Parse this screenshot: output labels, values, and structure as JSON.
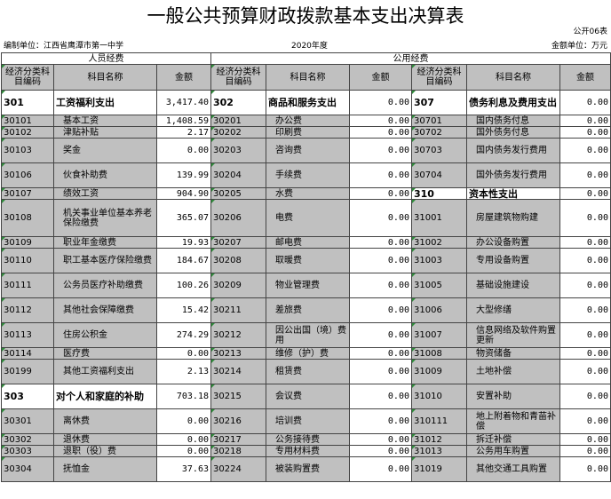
{
  "title": "一般公共预算财政拨款基本支出决算表",
  "table_code": "公开06表",
  "meta": {
    "unit": "编制单位：江西省鹰潭市第一中学",
    "year": "2020年度",
    "money_unit": "金额单位：万元"
  },
  "headers": {
    "personnel": "人员经费",
    "public": "公用经费",
    "code": "经济分类科目编码",
    "name": "科目名称",
    "amount": "金额"
  },
  "rows": [
    {
      "h": 28,
      "c1": "301",
      "n1": "工资福利支出",
      "a1": "3,417.40",
      "c2": "302",
      "n2": "商品和服务支出",
      "a2": "0.00",
      "c3": "307",
      "n3": "债务利息及费用支出",
      "a3": "0.00",
      "b1": true,
      "b2": true,
      "b3": true
    },
    {
      "h": 13,
      "c1": "30101",
      "n1": "基本工资",
      "a1": "1,408.59",
      "c2": "30201",
      "n2": "办公费",
      "a2": "0.00",
      "c3": "30701",
      "n3": "国内债务付息",
      "a3": "0.00"
    },
    {
      "h": 13,
      "c1": "30102",
      "n1": "津贴补贴",
      "a1": "2.17",
      "c2": "30202",
      "n2": "印刷费",
      "a2": "0.00",
      "c3": "30702",
      "n3": "国外债务付息",
      "a3": "0.00"
    },
    {
      "h": 28,
      "c1": "30103",
      "n1": "奖金",
      "a1": "0.00",
      "c2": "30203",
      "n2": "咨询费",
      "a2": "0.00",
      "c3": "30703",
      "n3": "国内债务发行费用",
      "a3": "0.00"
    },
    {
      "h": 28,
      "c1": "30106",
      "n1": "伙食补助费",
      "a1": "139.99",
      "c2": "30204",
      "n2": "手续费",
      "a2": "0.00",
      "c3": "30704",
      "n3": "国外债务发行费用",
      "a3": "0.00"
    },
    {
      "h": 13,
      "c1": "30107",
      "n1": "绩效工资",
      "a1": "904.90",
      "c2": "30205",
      "n2": "水费",
      "a2": "0.00",
      "c3": "310",
      "n3": "资本性支出",
      "a3": "0.00",
      "b3": true
    },
    {
      "h": 42,
      "c1": "30108",
      "n1": "机关事业单位基本养老保险缴费",
      "a1": "365.07",
      "c2": "30206",
      "n2": "电费",
      "a2": "0.00",
      "c3": "31001",
      "n3": "房屋建筑物购建",
      "a3": "0.00"
    },
    {
      "h": 13,
      "c1": "30109",
      "n1": "职业年金缴费",
      "a1": "19.93",
      "c2": "30207",
      "n2": "邮电费",
      "a2": "0.00",
      "c3": "31002",
      "n3": "办公设备购置",
      "a3": "0.00"
    },
    {
      "h": 28,
      "c1": "30110",
      "n1": "职工基本医疗保险缴费",
      "a1": "184.67",
      "c2": "30208",
      "n2": "取暖费",
      "a2": "0.00",
      "c3": "31003",
      "n3": "专用设备购置",
      "a3": "0.00"
    },
    {
      "h": 28,
      "c1": "30111",
      "n1": "公务员医疗补助缴费",
      "a1": "100.26",
      "c2": "30209",
      "n2": "物业管理费",
      "a2": "0.00",
      "c3": "31005",
      "n3": "基础设施建设",
      "a3": "0.00"
    },
    {
      "h": 28,
      "c1": "30112",
      "n1": "其他社会保障缴费",
      "a1": "15.42",
      "c2": "30211",
      "n2": "差旅费",
      "a2": "0.00",
      "c3": "31006",
      "n3": "大型修缮",
      "a3": "0.00"
    },
    {
      "h": 28,
      "c1": "30113",
      "n1": "住房公积金",
      "a1": "274.29",
      "c2": "30212",
      "n2": "因公出国（境）费用",
      "a2": "0.00",
      "c3": "31007",
      "n3": "信息网络及软件购置更新",
      "a3": "0.00"
    },
    {
      "h": 13,
      "c1": "30114",
      "n1": "医疗费",
      "a1": "0.00",
      "c2": "30213",
      "n2": "维修（护）费",
      "a2": "0.00",
      "c3": "31008",
      "n3": "物资储备",
      "a3": "0.00"
    },
    {
      "h": 28,
      "c1": "30199",
      "n1": "其他工资福利支出",
      "a1": "2.13",
      "c2": "30214",
      "n2": "租赁费",
      "a2": "0.00",
      "c3": "31009",
      "n3": "土地补偿",
      "a3": "0.00"
    },
    {
      "h": 28,
      "c1": "303",
      "n1": "对个人和家庭的补助",
      "a1": "703.18",
      "c2": "30215",
      "n2": "会议费",
      "a2": "0.00",
      "c3": "31010",
      "n3": "安置补助",
      "a3": "0.00",
      "b1": true
    },
    {
      "h": 28,
      "c1": "30301",
      "n1": "离休费",
      "a1": "0.00",
      "c2": "30216",
      "n2": "培训费",
      "a2": "0.00",
      "c3": "310111",
      "n3": "地上附着物和青苗补偿",
      "a3": "0.00"
    },
    {
      "h": 13,
      "c1": "30302",
      "n1": "退休费",
      "a1": "0.00",
      "c2": "30217",
      "n2": "公务接待费",
      "a2": "0.00",
      "c3": "31012",
      "n3": "拆迁补偿",
      "a3": "0.00"
    },
    {
      "h": 13,
      "c1": "30303",
      "n1": "退职（役）费",
      "a1": "0.00",
      "c2": "30218",
      "n2": "专用材料费",
      "a2": "0.00",
      "c3": "31013",
      "n3": "公务用车购置",
      "a3": "0.00"
    },
    {
      "h": 28,
      "c1": "30304",
      "n1": "抚恤金",
      "a1": "37.63",
      "c2": "30224",
      "n2": "被装购置费",
      "a2": "0.00",
      "c3": "31019",
      "n3": "其他交通工具购置",
      "a3": "0.00"
    }
  ]
}
